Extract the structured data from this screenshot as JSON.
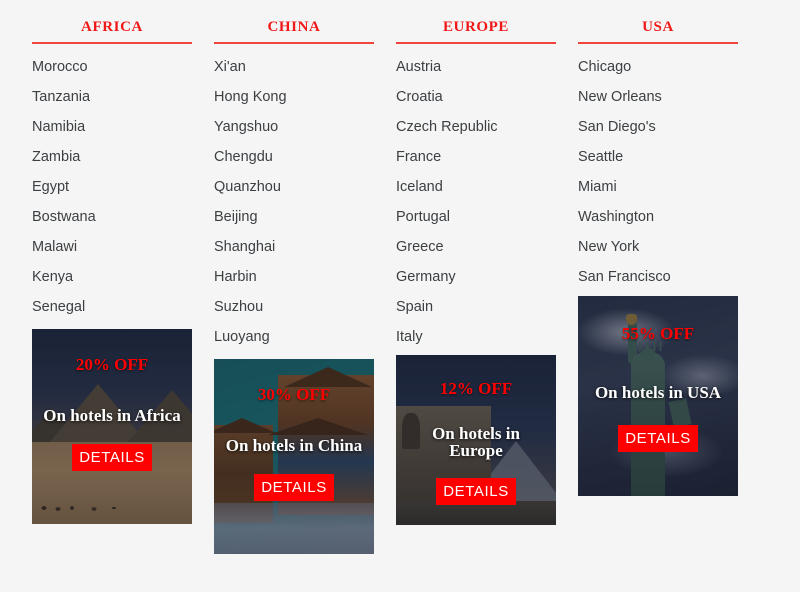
{
  "page": {
    "background_color": "#f5f5f5",
    "accent_color": "#ff0000",
    "heading_color": "#f01818",
    "text_color": "#3c4043"
  },
  "columns": [
    {
      "key": "africa",
      "heading": "AFRICA",
      "items": [
        "Morocco",
        "Tanzania",
        "Namibia",
        "Zambia",
        "Egypt",
        "Bostwana",
        "Malawi",
        "Kenya",
        "Senegal"
      ]
    },
    {
      "key": "china",
      "heading": "CHINA",
      "items": [
        "Xi'an",
        "Hong Kong",
        "Yangshuo",
        "Chengdu",
        "Quanzhou",
        "Beijing",
        "Shanghai",
        "Harbin",
        "Suzhou",
        "Luoyang"
      ]
    },
    {
      "key": "europe",
      "heading": "EUROPE",
      "items": [
        "Austria",
        "Croatia",
        "Czech Republic",
        "France",
        "Iceland",
        "Portugal",
        "Greece",
        "Germany",
        "Spain",
        "Italy"
      ]
    },
    {
      "key": "usa",
      "heading": "USA",
      "items": [
        "Chicago",
        "New Orleans",
        "San Diego's",
        "Seattle",
        "Miami",
        "Washington",
        "New York",
        "San Francisco"
      ]
    }
  ],
  "promos": [
    {
      "key": "africa",
      "discount": "20% OFF",
      "headline": "On hotels in Africa",
      "button_label": "DETAILS",
      "image_subject": "pyramids-of-giza"
    },
    {
      "key": "china",
      "discount": "30% OFF",
      "headline": "On hotels in China",
      "button_label": "DETAILS",
      "image_subject": "chinese-pagoda-temple"
    },
    {
      "key": "europe",
      "discount": "12% OFF",
      "headline": "On hotels in Europe",
      "button_label": "DETAILS",
      "image_subject": "louvre-museum-paris"
    },
    {
      "key": "usa",
      "discount": "55% OFF",
      "headline": "On hotels in USA",
      "button_label": "DETAILS",
      "image_subject": "statue-of-liberty"
    }
  ]
}
